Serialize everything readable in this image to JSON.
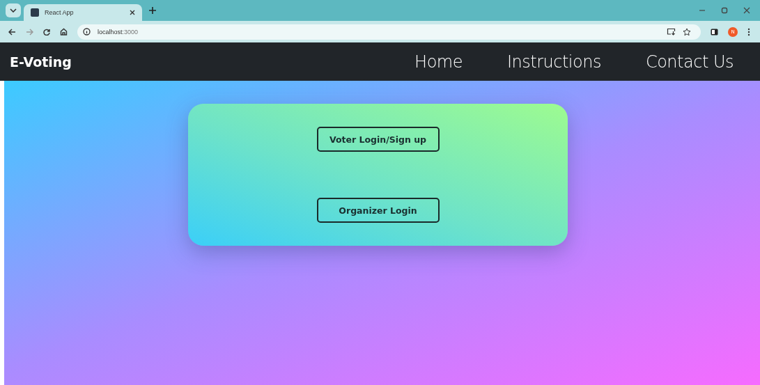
{
  "browser": {
    "tab_title": "React App",
    "url_host": "localhost",
    "url_port": ":3000",
    "profile_initial": "N"
  },
  "navbar": {
    "brand": "E-Voting",
    "links": [
      "Home",
      "Instructions",
      "Contact Us"
    ]
  },
  "card": {
    "buttons": [
      "Voter Login/Sign up",
      "Organizer Login"
    ]
  }
}
